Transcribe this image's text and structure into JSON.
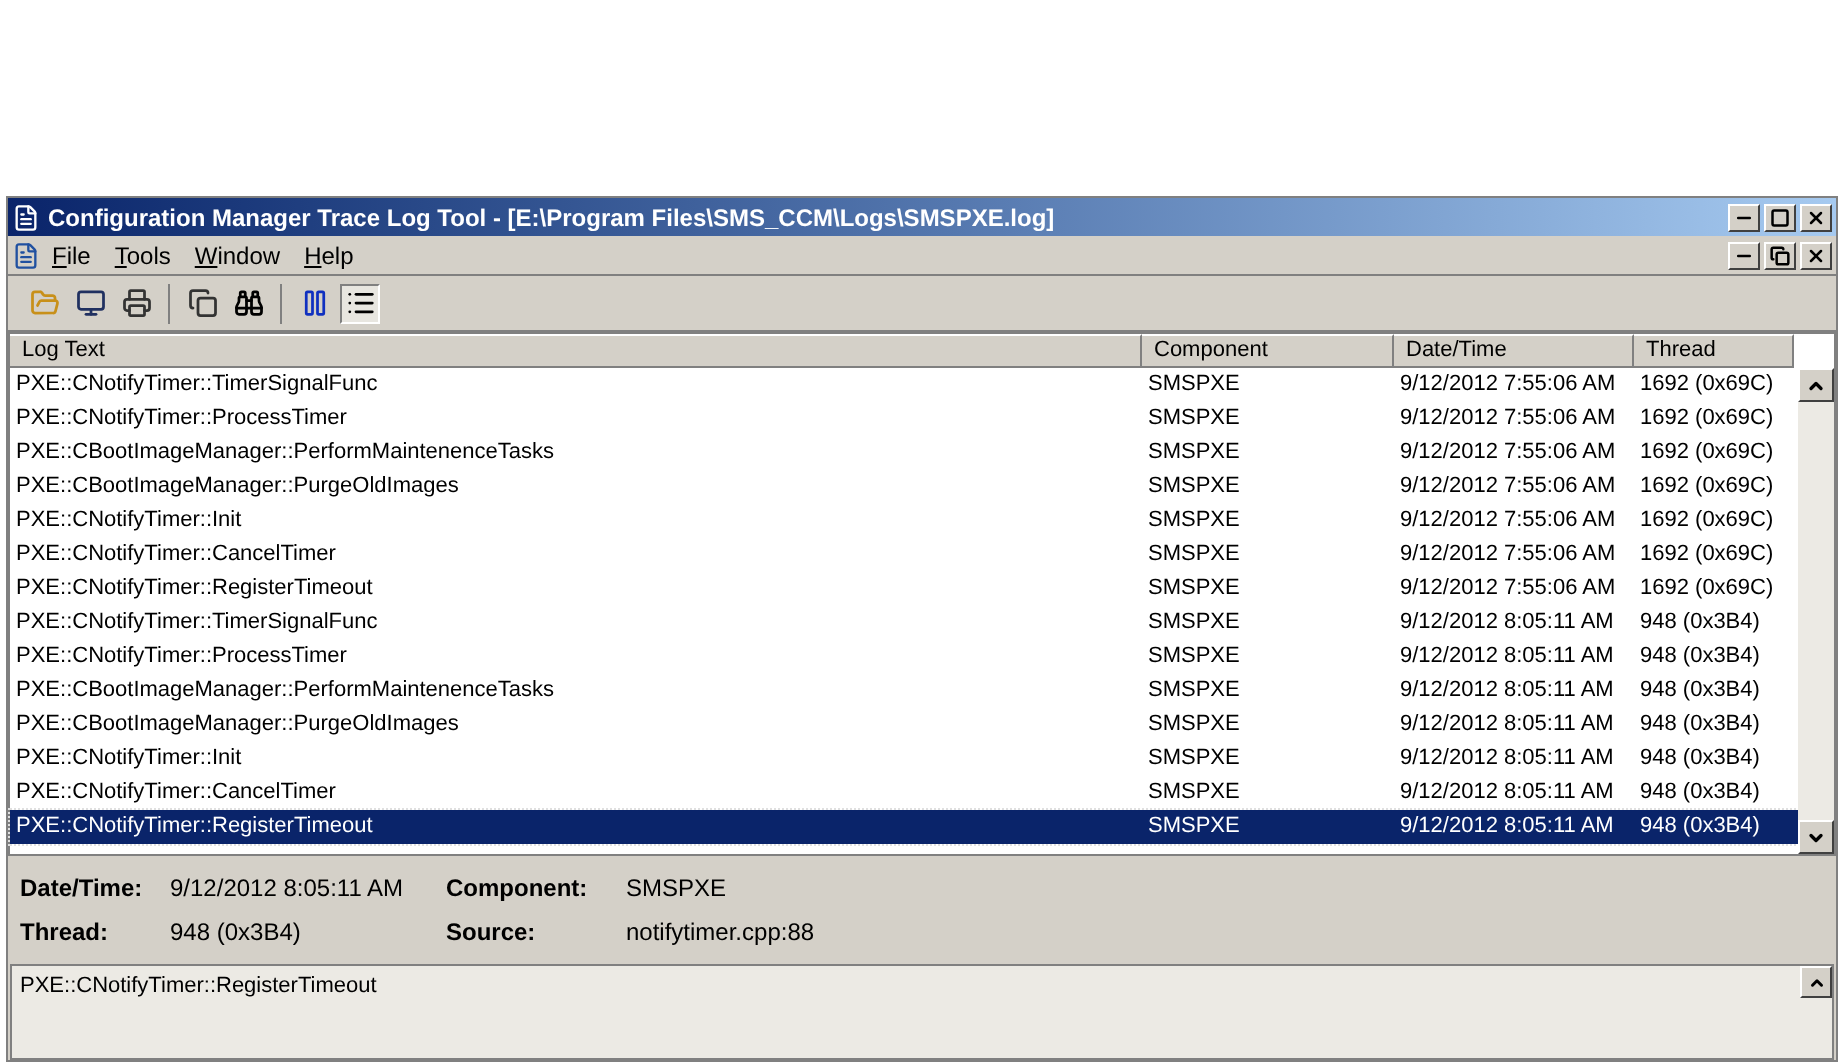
{
  "window": {
    "title": "Configuration Manager Trace Log Tool - [E:\\Program Files\\SMS_CCM\\Logs\\SMSPXE.log]"
  },
  "menu": [
    "File",
    "Tools",
    "Window",
    "Help"
  ],
  "toolbar": [
    {
      "kind": "open"
    },
    {
      "kind": "computer"
    },
    {
      "kind": "print"
    },
    {
      "kind": "copy"
    },
    {
      "kind": "find"
    },
    {
      "kind": "pause",
      "pressed": false
    },
    {
      "kind": "list",
      "pressed": true
    }
  ],
  "table": {
    "columns": [
      "Log Text",
      "Component",
      "Date/Time",
      "Thread"
    ],
    "rows": [
      {
        "cells": [
          "PXE::CNotifyTimer::TimerSignalFunc",
          "SMSPXE",
          "9/12/2012 7:55:06 AM",
          "1692 (0x69C)"
        ],
        "selected": false
      },
      {
        "cells": [
          "PXE::CNotifyTimer::ProcessTimer",
          "SMSPXE",
          "9/12/2012 7:55:06 AM",
          "1692 (0x69C)"
        ],
        "selected": false
      },
      {
        "cells": [
          "PXE::CBootImageManager::PerformMaintenenceTasks",
          "SMSPXE",
          "9/12/2012 7:55:06 AM",
          "1692 (0x69C)"
        ],
        "selected": false
      },
      {
        "cells": [
          "PXE::CBootImageManager::PurgeOldImages",
          "SMSPXE",
          "9/12/2012 7:55:06 AM",
          "1692 (0x69C)"
        ],
        "selected": false
      },
      {
        "cells": [
          "PXE::CNotifyTimer::Init",
          "SMSPXE",
          "9/12/2012 7:55:06 AM",
          "1692 (0x69C)"
        ],
        "selected": false
      },
      {
        "cells": [
          "PXE::CNotifyTimer::CancelTimer",
          "SMSPXE",
          "9/12/2012 7:55:06 AM",
          "1692 (0x69C)"
        ],
        "selected": false
      },
      {
        "cells": [
          "PXE::CNotifyTimer::RegisterTimeout",
          "SMSPXE",
          "9/12/2012 7:55:06 AM",
          "1692 (0x69C)"
        ],
        "selected": false
      },
      {
        "cells": [
          "PXE::CNotifyTimer::TimerSignalFunc",
          "SMSPXE",
          "9/12/2012 8:05:11 AM",
          "948 (0x3B4)"
        ],
        "selected": false
      },
      {
        "cells": [
          "PXE::CNotifyTimer::ProcessTimer",
          "SMSPXE",
          "9/12/2012 8:05:11 AM",
          "948 (0x3B4)"
        ],
        "selected": false
      },
      {
        "cells": [
          "PXE::CBootImageManager::PerformMaintenenceTasks",
          "SMSPXE",
          "9/12/2012 8:05:11 AM",
          "948 (0x3B4)"
        ],
        "selected": false
      },
      {
        "cells": [
          "PXE::CBootImageManager::PurgeOldImages",
          "SMSPXE",
          "9/12/2012 8:05:11 AM",
          "948 (0x3B4)"
        ],
        "selected": false
      },
      {
        "cells": [
          "PXE::CNotifyTimer::Init",
          "SMSPXE",
          "9/12/2012 8:05:11 AM",
          "948 (0x3B4)"
        ],
        "selected": false
      },
      {
        "cells": [
          "PXE::CNotifyTimer::CancelTimer",
          "SMSPXE",
          "9/12/2012 8:05:11 AM",
          "948 (0x3B4)"
        ],
        "selected": false
      },
      {
        "cells": [
          "PXE::CNotifyTimer::RegisterTimeout",
          "SMSPXE",
          "9/12/2012 8:05:11 AM",
          "948 (0x3B4)"
        ],
        "selected": true
      }
    ]
  },
  "details": [
    {
      "label": "Date/Time:",
      "value": "9/12/2012 8:05:11 AM"
    },
    {
      "label": "Component:",
      "value": "SMSPXE"
    },
    {
      "label": "Thread:",
      "value": "948 (0x3B4)"
    },
    {
      "label": "Source:",
      "value": "notifytimer.cpp:88"
    }
  ],
  "message": "PXE::CNotifyTimer::RegisterTimeout"
}
